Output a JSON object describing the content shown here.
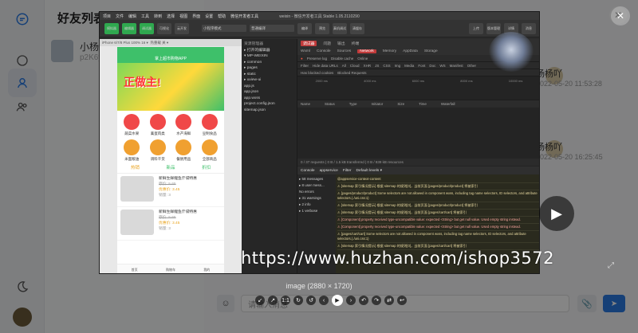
{
  "friends": {
    "title": "好友列表",
    "items": [
      {
        "name": "小杨",
        "sub": "p2K6yD"
      }
    ]
  },
  "chat": {
    "messages": [
      {
        "name": "杨杨吖",
        "time": "2022-05-20 11:53:28"
      },
      {
        "name": "杨杨吖",
        "time": "2022-05-20 16:25:45"
      }
    ],
    "input_placeholder": "请输入消息",
    "send_label": "➤"
  },
  "devtools": {
    "window_title": "weixin - 微信开发者工具 Stable 1.05.2110290",
    "menu": [
      "项目",
      "文件",
      "编辑",
      "工具",
      "转到",
      "选择",
      "视图",
      "界面",
      "设置",
      "帮助",
      "微信开发者工具"
    ],
    "toolbar_buttons": [
      "模拟器",
      "编辑器",
      "调试器",
      "可视化",
      "云开发"
    ],
    "mode_select": "小程序模式",
    "compile_select": "普通编译",
    "right_toolbar": [
      "编译",
      "预览",
      "真机调试",
      "清缓存",
      "上传",
      "版本管理",
      "详情",
      "消息"
    ],
    "sim_meta": "iPhone 6/7/8 Plus 100% 16 ▾",
    "sim_hotreload": "热重载 关 ▾",
    "phone": {
      "nav_title": "掌上超市购物APP",
      "banner_text": "正做主!",
      "categories": [
        {
          "label": "蔬菜水果",
          "color": "#f04848"
        },
        {
          "label": "禽蛋肉类",
          "color": "#f04848"
        },
        {
          "label": "水产海鲜",
          "color": "#f04848"
        },
        {
          "label": "豆制食品",
          "color": "#f04848"
        },
        {
          "label": "米面粮油",
          "color": "#f0a030"
        },
        {
          "label": "调料干货",
          "color": "#f0a030"
        },
        {
          "label": "餐厨用品",
          "color": "#f0a030"
        },
        {
          "label": "全部商品",
          "color": "#f0a030"
        }
      ],
      "tabs": [
        "热销",
        "新品",
        "折扣"
      ],
      "products": [
        {
          "title": "新鲜生鲜鲤鱼斤袋特惠",
          "old": "原价: 5.65",
          "price": "优惠价: 3.45",
          "sold": "销量: 3"
        },
        {
          "title": "新鲜生鲜鲤鱼斤袋特惠",
          "old": "原价: 5.65",
          "price": "优惠价: 3.45",
          "sold": "销量: 3"
        }
      ],
      "tabbar": [
        "首页",
        "购物车",
        "我的"
      ]
    },
    "tree": {
      "header": "资源管理器",
      "open_editors": "▸ 打开的编辑器",
      "project": "▾ MP-WEIXIN",
      "items": [
        "▸ common",
        "▸ pages",
        "▸ static",
        "▸ uview-ui",
        "  app.js",
        "  app.json",
        "  app.wxss",
        "  project.config.json",
        "  sitemap.json"
      ]
    },
    "tabs": [
      "调试器",
      "问题",
      "输出",
      "终端"
    ],
    "panel_tabs": [
      "Wxml",
      "Console",
      "Sources",
      "Network",
      "Memory",
      "AppData",
      "Storage"
    ],
    "active_panel": "Network",
    "network_filters": [
      "Preserve log",
      "Disable cache",
      "Online"
    ],
    "type_filters": [
      "Filter",
      "Hide data URLs",
      "All",
      "Cloud",
      "XHR",
      "JS",
      "CSS",
      "Img",
      "Media",
      "Font",
      "Doc",
      "WS",
      "Manifest",
      "Other"
    ],
    "extra_filters": [
      "Has blocked cookies",
      "Blocked Requests"
    ],
    "timeline_ticks": [
      "2000 ms",
      "4000 ms",
      "6000 ms",
      "8000 ms",
      "10000 ms"
    ],
    "columns": [
      "Name",
      "Status",
      "Type",
      "Initiator",
      "Size",
      "Time",
      "Waterfall"
    ],
    "network_footer": "0 / 37 requests  |  0 B / 1.5 kB transferred  |  0 B / 839 kB resources",
    "console_title": "Console",
    "console_context": "appservice",
    "console_filter_placeholder": "Filter",
    "console_levels": "Default levels ▾",
    "console_side": [
      "▸ 58 messages",
      "▸ 8 user mess...",
      "  No errors",
      "▸ 31 warnings",
      "▸ 2 info",
      "▸ 1 verbose"
    ],
    "console_lines": [
      {
        "text": "@appservice-context-content",
        "err": false
      },
      {
        "text": "⚠ [sitemap 索引情况提示] 根据 sitemap 的规则[0]，当前页面 [pages/product/product] 将被索引",
        "err": false
      },
      {
        "text": "⚠ [pages/product/product] Some selectors are not allowed in component wxss, including tag name selectors, ID selectors, and attribute selectors.(./uni.css:1)",
        "err": false
      },
      {
        "text": "⚠ [sitemap 索引情况提示] 根据 sitemap 的规则[0]，当前页面 [pages/product/product] 将被索引",
        "err": false
      },
      {
        "text": "⚠ [sitemap 索引情况提示] 根据 sitemap 的规则[0]，当前页面 [pages/cart/cart] 将被索引",
        "err": false
      },
      {
        "text": "⚠ [Component] property received type-uncompatible value: expected <String> but get null value. Used empty string instead.",
        "err": true
      },
      {
        "text": "⚠ [Component] property received type-uncompatible value: expected <String> but get null value. Used empty string instead.",
        "err": true
      },
      {
        "text": "⚠ [pages/cart/cart] Some selectors are not allowed in component wxss, including tag name selectors, ID selectors, and attribute selectors.(./uni.css:1)",
        "err": false
      },
      {
        "text": "⚠ [sitemap 索引情况提示] 根据 sitemap 的规则[0]，当前页面 [pages/cart/cart] 将被索引",
        "err": false
      }
    ],
    "status_bar": "页面路径 ▾  pages/index/index"
  },
  "overlay": {
    "watermark": "https://www.huzhan.com/ishop3572",
    "caption": "image (2880 × 1720)",
    "viewer_buttons": [
      "↙",
      "↗",
      "1:1",
      "↻",
      "↺",
      "‹",
      "▶",
      "›",
      "↶",
      "↷",
      "⇄",
      "↩"
    ]
  },
  "colors": {
    "accent": "#2b7be4",
    "phone_green": "#3ec06a",
    "price_orange": "#e9a21c"
  }
}
